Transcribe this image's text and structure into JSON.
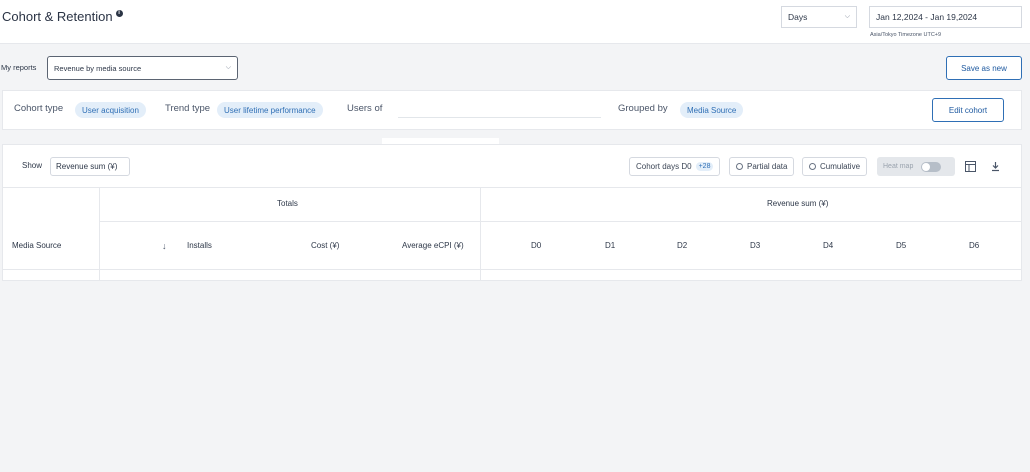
{
  "header": {
    "title": "Cohort & Retention",
    "period_select": "Days",
    "date_range": "Jan 12,2024 - Jan 19,2024",
    "timezone": "Asia/Tokyo Timezone UTC+9"
  },
  "reports": {
    "label": "My reports",
    "selected": "Revenue by media source",
    "save_label": "Save as new"
  },
  "cohort_config": {
    "cohort_type_label": "Cohort type",
    "cohort_type_value": "User acquisition",
    "trend_type_label": "Trend type",
    "trend_type_value": "User lifetime performance",
    "users_of_label": "Users of",
    "grouped_by_label": "Grouped by",
    "grouped_by_value": "Media Source",
    "edit_label": "Edit cohort"
  },
  "toolbar": {
    "show_label": "Show",
    "show_value": "Revenue sum (¥)",
    "cohort_days_label": "Cohort days D0",
    "cohort_days_extra": "+28",
    "partial_data_label": "Partial data",
    "cumulative_label": "Cumulative",
    "heatmap_label": "Heat map"
  },
  "table": {
    "group_totals": "Totals",
    "group_revenue": "Revenue sum (¥)",
    "col_media_source": "Media Source",
    "col_installs": "Installs",
    "col_cost": "Cost (¥)",
    "col_ecpi": "Average eCPI (¥)",
    "day_columns": [
      "D0",
      "D1",
      "D2",
      "D3",
      "D4",
      "D5",
      "D6"
    ]
  },
  "icons": {
    "info": "info-icon",
    "chevron": "chevron-down-icon",
    "sort": "arrow-down-icon",
    "table_settings": "table-layout-icon",
    "download": "download-icon"
  },
  "colors": {
    "accent": "#2f6fb5",
    "chip_bg": "#e3eef9"
  }
}
